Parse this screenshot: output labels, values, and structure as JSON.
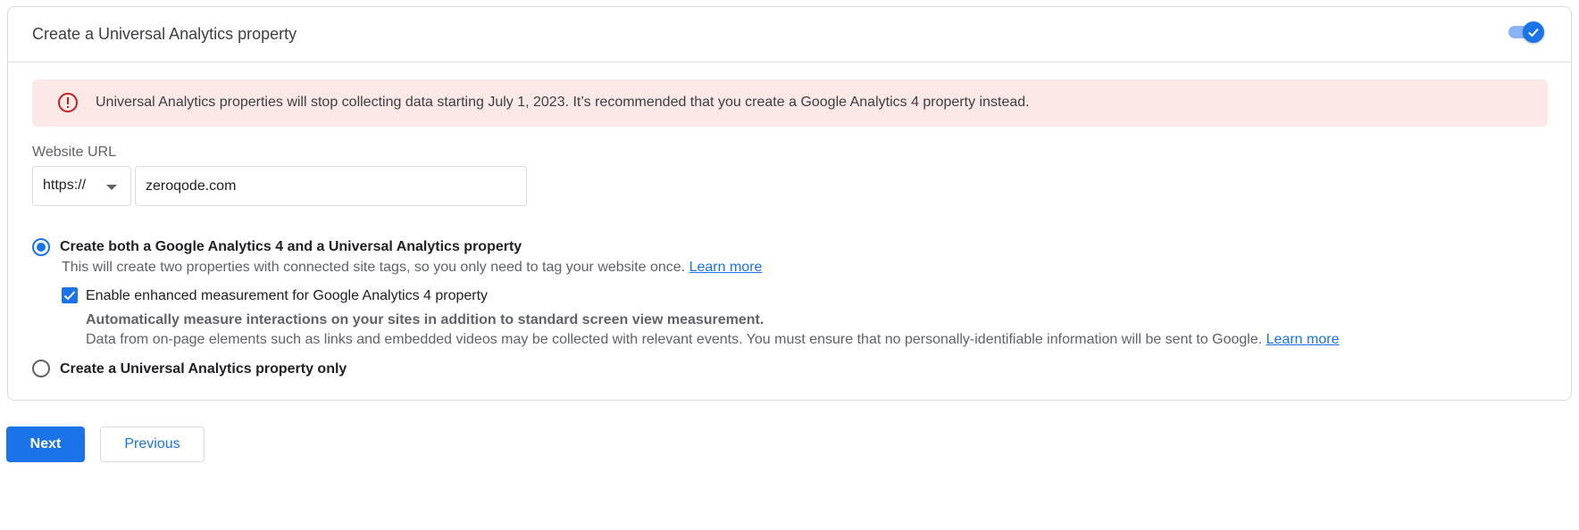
{
  "card": {
    "title": "Create a Universal Analytics property",
    "toggle_on": true
  },
  "alert": {
    "icon": "error-icon",
    "text": "Universal Analytics properties will stop collecting data starting July 1, 2023. It’s recommended that you create a Google Analytics 4 property instead."
  },
  "website_url": {
    "label": "Website URL",
    "protocol_selected": "https://",
    "url_value": "zeroqode.com"
  },
  "options": {
    "both": {
      "label": "Create both a Google Analytics 4 and a Universal Analytics property",
      "description": "This will create two properties with connected site tags, so you only need to tag your website once.",
      "learn_more": "Learn more",
      "selected": true
    },
    "enhanced": {
      "checkbox_label": "Enable enhanced measurement for Google Analytics 4 property",
      "bold_text": "Automatically measure interactions on your sites in addition to standard screen view measurement.",
      "description": "Data from on-page elements such as links and embedded videos may be collected with relevant events. You must ensure that no personally-identifiable information will be sent to Google.",
      "learn_more": "Learn more",
      "checked": true
    },
    "ua_only": {
      "label": "Create a Universal Analytics property only",
      "selected": false
    }
  },
  "buttons": {
    "next": "Next",
    "previous": "Previous"
  },
  "colors": {
    "primary": "#1a73e8",
    "alert_bg": "#fce8e6",
    "alert_icon": "#c5221f",
    "border": "#dadce0"
  }
}
